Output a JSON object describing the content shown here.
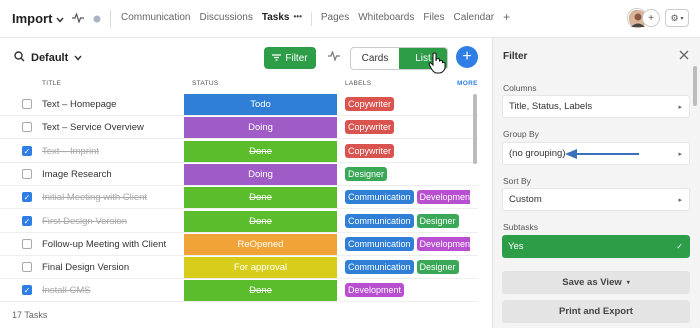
{
  "app": {
    "project": "Import",
    "tabs": [
      "Communication",
      "Discussions",
      "Tasks",
      "Pages",
      "Whiteboards",
      "Files",
      "Calendar"
    ],
    "active_tab": "Tasks",
    "tab_more": "•••",
    "add_tab": "+",
    "add_member": "+"
  },
  "toolbar": {
    "view": "Default",
    "filter_label": "Filter",
    "view_cards": "Cards",
    "view_list": "List",
    "active_view": "List",
    "add_label": "+"
  },
  "table": {
    "headers": {
      "title": "TITLE",
      "status": "STATUS",
      "labels": "LABELS",
      "more": "MORE"
    },
    "rows": [
      {
        "title": "Text – Homepage",
        "done": false,
        "status": "Todo",
        "status_color": "#2f7fd6",
        "labels": [
          {
            "text": "Copywriter",
            "color": "#d9534f"
          }
        ]
      },
      {
        "title": "Text – Service Overview",
        "done": false,
        "status": "Doing",
        "status_color": "#a05cc6",
        "labels": [
          {
            "text": "Copywriter",
            "color": "#d9534f"
          }
        ]
      },
      {
        "title": "Text – Imprint",
        "done": true,
        "status": "Done",
        "status_color": "#5bbd2b",
        "labels": [
          {
            "text": "Copywriter",
            "color": "#d9534f"
          }
        ]
      },
      {
        "title": "Image Research",
        "done": false,
        "status": "Doing",
        "status_color": "#a05cc6",
        "labels": [
          {
            "text": "Designer",
            "color": "#3aa856"
          }
        ]
      },
      {
        "title": "Initial Meeting with Client",
        "done": true,
        "status": "Done",
        "status_color": "#5bbd2b",
        "labels": [
          {
            "text": "Communication",
            "color": "#2f7fd6"
          },
          {
            "text": "Development",
            "color": "#b84fd1"
          }
        ]
      },
      {
        "title": "First Design Version",
        "done": true,
        "status": "Done",
        "status_color": "#5bbd2b",
        "labels": [
          {
            "text": "Communication",
            "color": "#2f7fd6"
          },
          {
            "text": "Designer",
            "color": "#3aa856"
          }
        ]
      },
      {
        "title": "Follow-up Meeting with Client",
        "done": false,
        "status": "ReOpened",
        "status_color": "#f0a437",
        "labels": [
          {
            "text": "Communication",
            "color": "#2f7fd6"
          },
          {
            "text": "Development",
            "color": "#b84fd1"
          }
        ]
      },
      {
        "title": "Final Design Version",
        "done": false,
        "status": "For approval",
        "status_color": "#d9cd1c",
        "labels": [
          {
            "text": "Communication",
            "color": "#2f7fd6"
          },
          {
            "text": "Designer",
            "color": "#3aa856"
          }
        ]
      },
      {
        "title": "Install CMS",
        "done": true,
        "status": "Done",
        "status_color": "#5bbd2b",
        "labels": [
          {
            "text": "Development",
            "color": "#b84fd1"
          }
        ]
      }
    ],
    "footer": "17 Tasks"
  },
  "filter_panel": {
    "title": "Filter",
    "columns_label": "Columns",
    "columns_value": "Title, Status, Labels",
    "group_by_label": "Group By",
    "group_by_value": "(no grouping)",
    "sort_by_label": "Sort By",
    "sort_by_value": "Custom",
    "subtasks_label": "Subtasks",
    "subtasks_value": "Yes",
    "save_view_label": "Save as View",
    "print_export_label": "Print and Export"
  },
  "colors": {
    "accent_green": "#2e9d48",
    "accent_blue": "#2f7ee6",
    "arrow": "#3b6fb8"
  },
  "icons": [
    "chevron-down-icon",
    "activity-icon",
    "status-dot-icon",
    "more-icon",
    "plus-icon",
    "avatar",
    "gear-icon",
    "search-icon",
    "filter-icon",
    "pulse-icon",
    "close-icon",
    "check-icon",
    "hand-cursor-icon",
    "arrow-annotation"
  ]
}
